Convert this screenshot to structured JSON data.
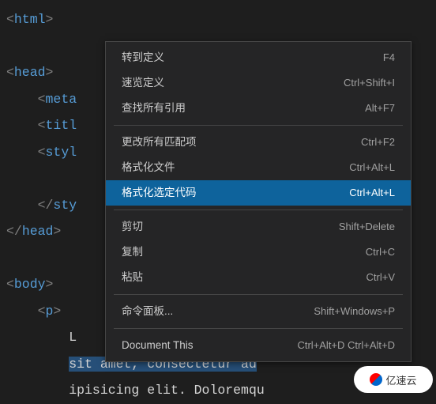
{
  "code": {
    "line1": {
      "open": "<",
      "tag": "html",
      "close": ">"
    },
    "line3": {
      "open": "<",
      "tag": "head",
      "close": ">"
    },
    "line4": {
      "indent": "    ",
      "open": "<",
      "tag": "meta"
    },
    "line5": {
      "indent": "    ",
      "open": "<",
      "tag": "titl"
    },
    "line6": {
      "indent": "    ",
      "open": "<",
      "tag": "styl"
    },
    "line8": {
      "indent": "    ",
      "open": "</",
      "tag": "sty"
    },
    "line9": {
      "open": "</",
      "tag": "head",
      "close": ">"
    },
    "line11": {
      "open": "<",
      "tag": "body",
      "close": ">"
    },
    "line12": {
      "indent": "    ",
      "open": "<",
      "tag": "p",
      "close": ">"
    },
    "line13": {
      "indent": "        ",
      "text": "L"
    },
    "line14": {
      "indent": "        ",
      "text": "sit amet, consectetur ad"
    },
    "line15": {
      "indent": "        ",
      "text": "ipisicing elit. Doloremqu"
    }
  },
  "menu": {
    "group1": [
      {
        "label": "转到定义",
        "shortcut": "F4"
      },
      {
        "label": "速览定义",
        "shortcut": "Ctrl+Shift+I"
      },
      {
        "label": "查找所有引用",
        "shortcut": "Alt+F7"
      }
    ],
    "group2": [
      {
        "label": "更改所有匹配项",
        "shortcut": "Ctrl+F2"
      },
      {
        "label": "格式化文件",
        "shortcut": "Ctrl+Alt+L"
      },
      {
        "label": "格式化选定代码",
        "shortcut": "Ctrl+Alt+L",
        "selected": true
      }
    ],
    "group3": [
      {
        "label": "剪切",
        "shortcut": "Shift+Delete"
      },
      {
        "label": "复制",
        "shortcut": "Ctrl+C"
      },
      {
        "label": "粘贴",
        "shortcut": "Ctrl+V"
      }
    ],
    "group4": [
      {
        "label": "命令面板...",
        "shortcut": "Shift+Windows+P"
      }
    ],
    "group5": [
      {
        "label": "Document This",
        "shortcut": "Ctrl+Alt+D Ctrl+Alt+D"
      }
    ]
  },
  "watermark": "亿速云"
}
